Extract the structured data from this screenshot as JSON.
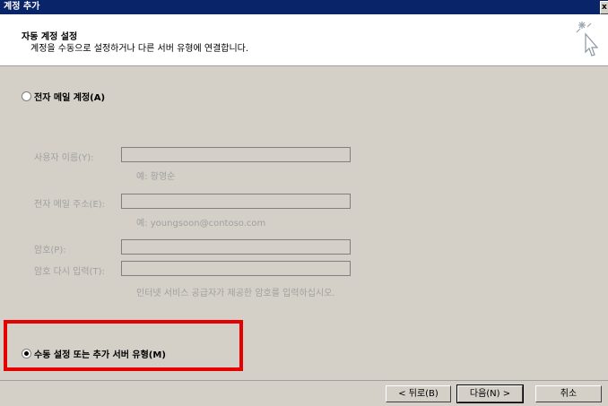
{
  "window": {
    "title": "계정 추가",
    "close_label": "x"
  },
  "header": {
    "title": "자동 계정 설정",
    "subtitle": "계정을 수동으로 설정하거나 다른 서버 유형에 연결합니다."
  },
  "options": {
    "email_account": {
      "label": "전자 메일 계정(A)",
      "selected": false
    },
    "manual_setup": {
      "label": "수동 설정 또는 추가 서버 유형(M)",
      "selected": true
    }
  },
  "form": {
    "name": {
      "label": "사용자 이름(Y):",
      "value": "",
      "hint": "예: 황영순"
    },
    "email": {
      "label": "전자 메일 주소(E):",
      "value": "",
      "hint": "예: youngsoon@contoso.com"
    },
    "password": {
      "label": "암호(P):",
      "value": ""
    },
    "password_confirm": {
      "label": "암호 다시 입력(T):",
      "value": "",
      "hint": "인터넷 서비스 공급자가 제공한 암호를 입력하십시오."
    }
  },
  "buttons": {
    "back": "< 뒤로(B)",
    "next": "다음(N) >",
    "cancel": "취소"
  },
  "colors": {
    "highlight": "#e60000",
    "titlebar": "#0a246a"
  }
}
